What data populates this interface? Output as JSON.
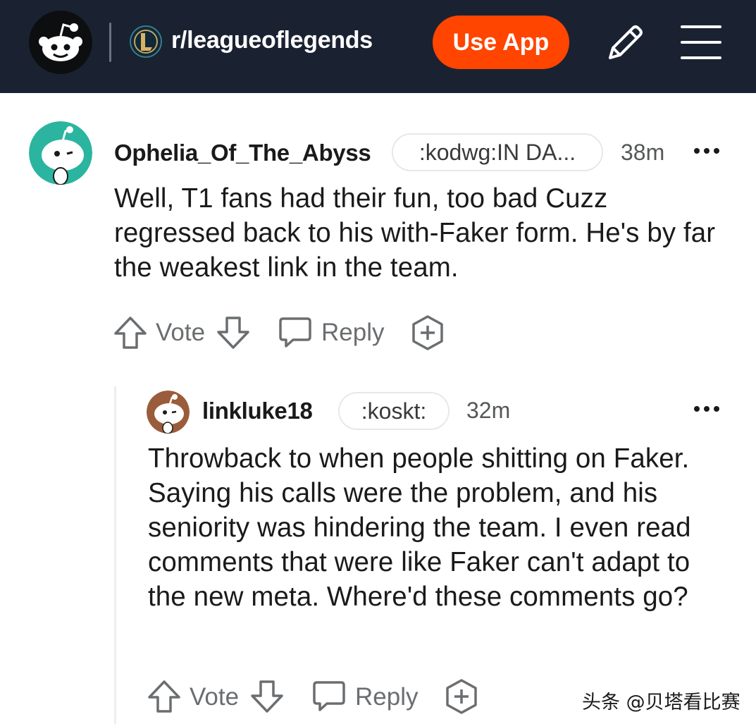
{
  "header": {
    "logo_icon": "reddit-snoo-icon",
    "subreddit_icon": "league-of-legends-icon",
    "subreddit": "r/leagueoflegends",
    "use_app_label": "Use App",
    "edit_icon": "pencil-icon",
    "menu_icon": "hamburger-menu-icon",
    "accent_color": "#ff4500",
    "background_color": "#1a2232"
  },
  "comments": [
    {
      "username": "Ophelia_Of_The_Abyss",
      "flair": ":kodwg:IN DA...",
      "time": "38m",
      "text": "Well, T1 fans had their fun, too bad Cuzz regressed back to his with-Faker form. He's by far the weakest link in the team.",
      "vote_label": "Vote",
      "reply_label": "Reply",
      "avatar_color": "#2bb5a0"
    },
    {
      "username": "linkluke18",
      "flair": ":koskt:",
      "time": "32m",
      "text": "Throwback to when people shitting on Faker. Saying his calls were the problem, and his seniority was hindering the team. I even read comments that were like Faker can't adapt to the new meta. Where'd these comments go?",
      "vote_label": "Vote",
      "reply_label": "Reply",
      "avatar_color": "#9a5c3a"
    }
  ],
  "watermark": "头条 @贝塔看比赛"
}
